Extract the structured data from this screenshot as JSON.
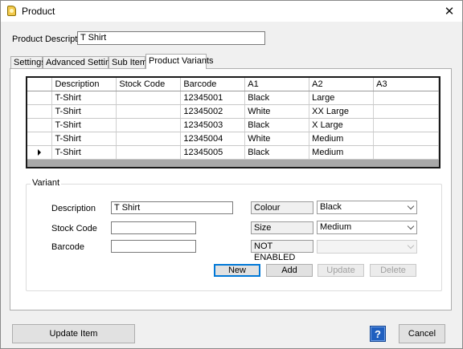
{
  "window": {
    "title": "Product",
    "icon": "product-tag-icon",
    "close_glyph": "✕"
  },
  "product": {
    "description_label": "Product Description",
    "description_value": "T Shirt"
  },
  "tabs": [
    {
      "label": "Settings",
      "active": false
    },
    {
      "label": "Advanced Settings",
      "active": false
    },
    {
      "label": "Sub Items",
      "active": false
    },
    {
      "label": "Product Variants",
      "active": true
    }
  ],
  "grid": {
    "columns": [
      "Description",
      "Stock Code",
      "Barcode",
      "A1",
      "A2",
      "A3"
    ],
    "rows": [
      {
        "selected": false,
        "cells": [
          "T-Shirt",
          "",
          "12345001",
          "Black",
          "Large",
          ""
        ]
      },
      {
        "selected": false,
        "cells": [
          "T-Shirt",
          "",
          "12345002",
          "White",
          "XX Large",
          ""
        ]
      },
      {
        "selected": false,
        "cells": [
          "T-Shirt",
          "",
          "12345003",
          "Black",
          "X Large",
          ""
        ]
      },
      {
        "selected": false,
        "cells": [
          "T-Shirt",
          "",
          "12345004",
          "White",
          "Medium",
          ""
        ]
      },
      {
        "selected": true,
        "cells": [
          "T-Shirt",
          "",
          "12345005",
          "Black",
          "Medium",
          ""
        ]
      }
    ]
  },
  "variant": {
    "group_title": "Variant",
    "description_label": "Description",
    "description_value": "T Shirt",
    "stock_code_label": "Stock Code",
    "stock_code_value": "",
    "barcode_label": "Barcode",
    "barcode_value": "",
    "attr1_name": "Colour",
    "attr1_value": "Black",
    "attr2_name": "Size",
    "attr2_value": "Medium",
    "attr3_name": "NOT ENABLED",
    "attr3_value": "",
    "buttons": {
      "new": "New",
      "add": "Add",
      "update": "Update",
      "delete": "Delete"
    }
  },
  "footer": {
    "update_item": "Update Item",
    "help": "?",
    "cancel": "Cancel"
  },
  "colors": {
    "window_bg": "#f0f0f0",
    "panel_bg": "#ffffff",
    "accent_focus": "#0078d7",
    "help_blue": "#1f5fbf"
  }
}
